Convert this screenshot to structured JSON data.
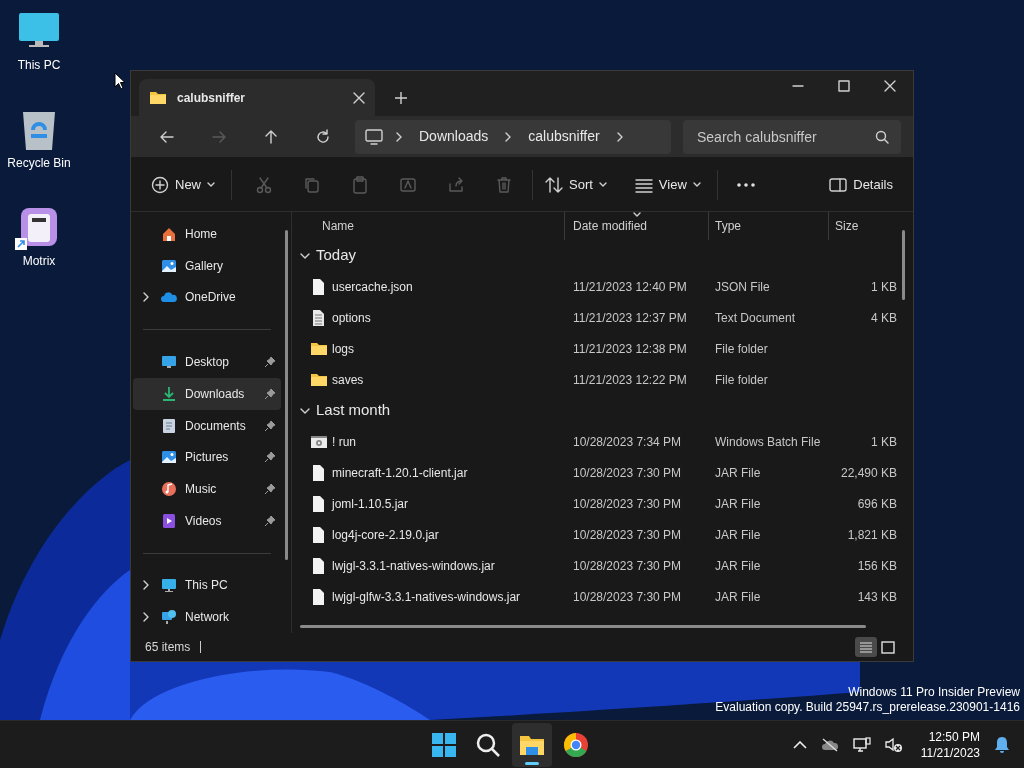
{
  "desktop_icons": [
    {
      "label": "This PC",
      "kind": "pc",
      "shortcut": false
    },
    {
      "label": "Recycle Bin",
      "kind": "bin",
      "shortcut": false
    },
    {
      "label": "Motrix",
      "kind": "app",
      "shortcut": true
    }
  ],
  "window": {
    "tab_title": "calubsniffer",
    "address": [
      "Downloads",
      "calubsniffer"
    ],
    "search": {
      "placeholder": "Search calubsniffer"
    },
    "toolbar": {
      "new": "New",
      "sort": "Sort",
      "view": "View",
      "details": "Details"
    },
    "sidebar": [
      [
        {
          "label": "Home",
          "kind": "home",
          "expandable": false,
          "pinned": false,
          "selected": false
        },
        {
          "label": "Gallery",
          "kind": "gallery",
          "expandable": false,
          "pinned": false,
          "selected": false
        },
        {
          "label": "OneDrive",
          "kind": "cloud",
          "expandable": true,
          "pinned": false,
          "selected": false
        }
      ],
      [
        {
          "label": "Desktop",
          "kind": "desktop",
          "expandable": false,
          "pinned": true,
          "selected": false
        },
        {
          "label": "Downloads",
          "kind": "download",
          "expandable": false,
          "pinned": true,
          "selected": true
        },
        {
          "label": "Documents",
          "kind": "document",
          "expandable": false,
          "pinned": true,
          "selected": false
        },
        {
          "label": "Pictures",
          "kind": "gallery",
          "expandable": false,
          "pinned": true,
          "selected": false
        },
        {
          "label": "Music",
          "kind": "music",
          "expandable": false,
          "pinned": true,
          "selected": false
        },
        {
          "label": "Videos",
          "kind": "video",
          "expandable": false,
          "pinned": true,
          "selected": false
        }
      ],
      [
        {
          "label": "This PC",
          "kind": "pc",
          "expandable": true,
          "pinned": false,
          "selected": false
        },
        {
          "label": "Network",
          "kind": "network",
          "expandable": true,
          "pinned": false,
          "selected": false
        }
      ]
    ],
    "columns": [
      {
        "label": "Name",
        "sorted": false
      },
      {
        "label": "Date modified",
        "sorted": true
      },
      {
        "label": "Type",
        "sorted": false
      },
      {
        "label": "Size",
        "sorted": false
      }
    ],
    "groups": [
      {
        "label": "Today",
        "expanded": true,
        "rows": [
          {
            "name": "usercache.json",
            "kind": "file",
            "date": "11/21/2023 12:40 PM",
            "type": "JSON File",
            "size": "1 KB"
          },
          {
            "name": "options",
            "kind": "text",
            "date": "11/21/2023 12:37 PM",
            "type": "Text Document",
            "size": "4 KB"
          },
          {
            "name": "logs",
            "kind": "folder",
            "date": "11/21/2023 12:38 PM",
            "type": "File folder"
          },
          {
            "name": "saves",
            "kind": "folder",
            "date": "11/21/2023 12:22 PM",
            "type": "File folder"
          }
        ]
      },
      {
        "label": "Last month",
        "expanded": true,
        "rows": [
          {
            "name": "! run",
            "kind": "batch",
            "date": "10/28/2023 7:34 PM",
            "type": "Windows Batch File",
            "size": "1 KB"
          },
          {
            "name": "minecraft-1.20.1-client.jar",
            "kind": "file",
            "date": "10/28/2023 7:30 PM",
            "type": "JAR File",
            "size": "22,490 KB"
          },
          {
            "name": "joml-1.10.5.jar",
            "kind": "file",
            "date": "10/28/2023 7:30 PM",
            "type": "JAR File",
            "size": "696 KB"
          },
          {
            "name": "log4j-core-2.19.0.jar",
            "kind": "file",
            "date": "10/28/2023 7:30 PM",
            "type": "JAR File",
            "size": "1,821 KB"
          },
          {
            "name": "lwjgl-3.3.1-natives-windows.jar",
            "kind": "file",
            "date": "10/28/2023 7:30 PM",
            "type": "JAR File",
            "size": "156 KB"
          },
          {
            "name": "lwjgl-glfw-3.3.1-natives-windows.jar",
            "kind": "file",
            "date": "10/28/2023 7:30 PM",
            "type": "JAR File",
            "size": "143 KB"
          }
        ]
      }
    ],
    "status": "65 items",
    "views": [
      {
        "kind": "details",
        "selected": true
      },
      {
        "kind": "tiles",
        "selected": false
      }
    ]
  },
  "watermark_os": [
    "Windows 11 Pro Insider Preview",
    "Evaluation copy. Build 25947.rs_prerelease.230901-1416"
  ],
  "taskbar": {
    "apps": [
      {
        "kind": "start",
        "active": false
      },
      {
        "kind": "search",
        "active": false
      },
      {
        "kind": "explorer",
        "active": true
      },
      {
        "kind": "chrome",
        "active": false
      }
    ],
    "time": "12:50 PM",
    "date": "11/21/2023"
  }
}
